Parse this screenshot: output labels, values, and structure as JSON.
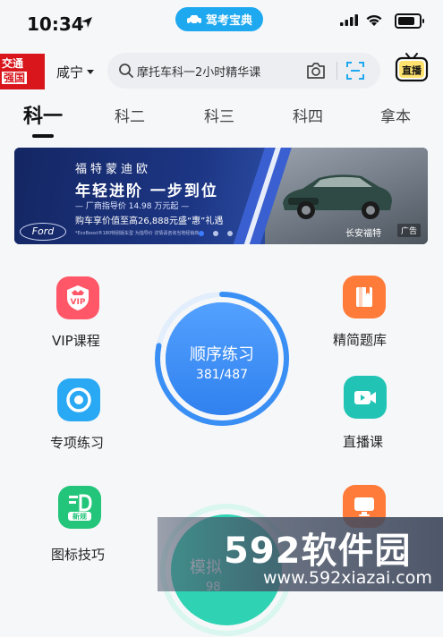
{
  "status_bar": {
    "time": "10:34",
    "app_name": "驾考宝典"
  },
  "header": {
    "logo_line1": "交通",
    "logo_line2": "强国",
    "city": "咸宁",
    "search_placeholder": "摩托车科一2小时精华课",
    "live_label": "直播"
  },
  "tabs": [
    {
      "label": "科一",
      "active": true
    },
    {
      "label": "科二",
      "active": false
    },
    {
      "label": "科三",
      "active": false
    },
    {
      "label": "科四",
      "active": false
    },
    {
      "label": "拿本",
      "active": false
    }
  ],
  "banner": {
    "line1": "福特蒙迪欧",
    "line2": "年轻进阶 一步到位",
    "line3": "— 厂商指导价 14.98 万元起 —",
    "line4": "购车享价值至高26,888元盛“惠”礼遇",
    "fineprint": "*EcoBoost®180特别版车型 为指导价 详情请咨询当地经销商",
    "ford_logo": "Ford",
    "brand": "长安福特",
    "ad_badge": "广告",
    "slide_count": 3,
    "active_slide": 1
  },
  "features": {
    "vip": "VIP课程",
    "question_bank": "精简题库",
    "special_practice": "专项练习",
    "live_class": "直播课",
    "sign_tips": "图标技巧",
    "new_badge": "新规"
  },
  "sequential_practice": {
    "label": "顺序练习",
    "progress": "381/487",
    "done": 381,
    "total": 487
  },
  "mock_exam": {
    "label": "模拟",
    "partial_number": "98"
  },
  "watermark": {
    "big": "592软件园",
    "small": "www.592xiazai.com"
  },
  "colors": {
    "accent_blue": "#1ea8ef",
    "ring_blue": "#3a8ff5",
    "mock_teal": "#2fd3b3",
    "banner_navy": "#1b2c6e"
  }
}
